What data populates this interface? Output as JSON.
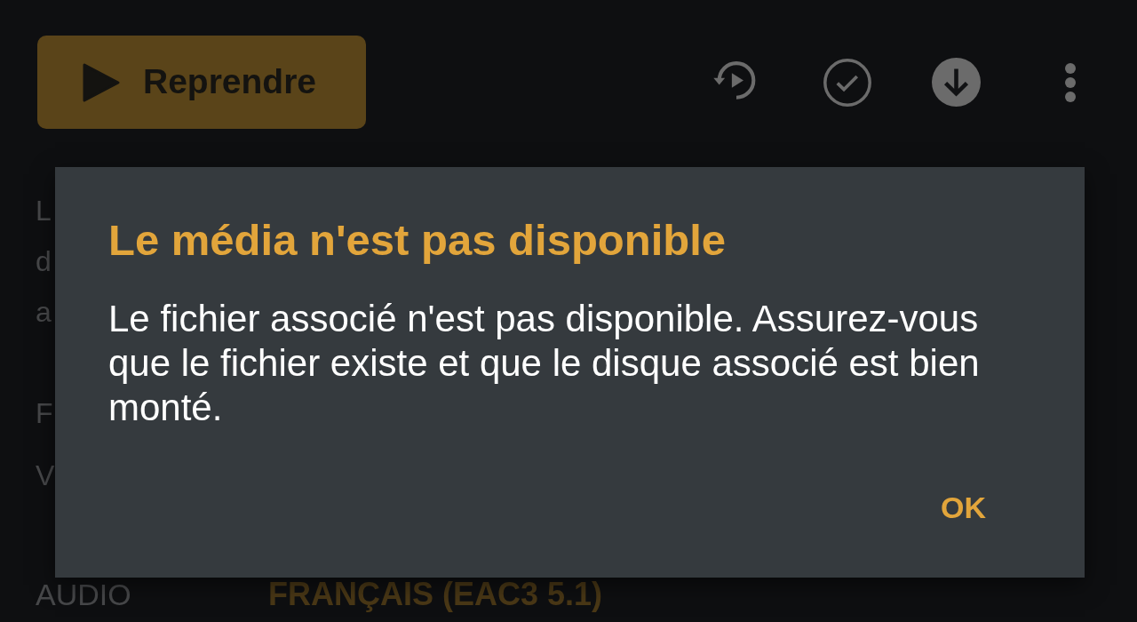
{
  "resume_button": {
    "label": "Reprendre"
  },
  "background_page": {
    "overview_fragments": [
      "L",
      "d",
      "a"
    ],
    "details": [
      {
        "label": "F"
      },
      {
        "label": "V"
      },
      {
        "label": "AUDIO",
        "value": "FRANÇAIS (EAC3 5.1)"
      }
    ]
  },
  "dialog": {
    "title": "Le média n'est pas disponible",
    "message": "Le fichier associé n'est pas disponible. Assurez-vous que le fichier existe et que le disque associé est bien monté.",
    "buttons": [
      "OK"
    ]
  }
}
